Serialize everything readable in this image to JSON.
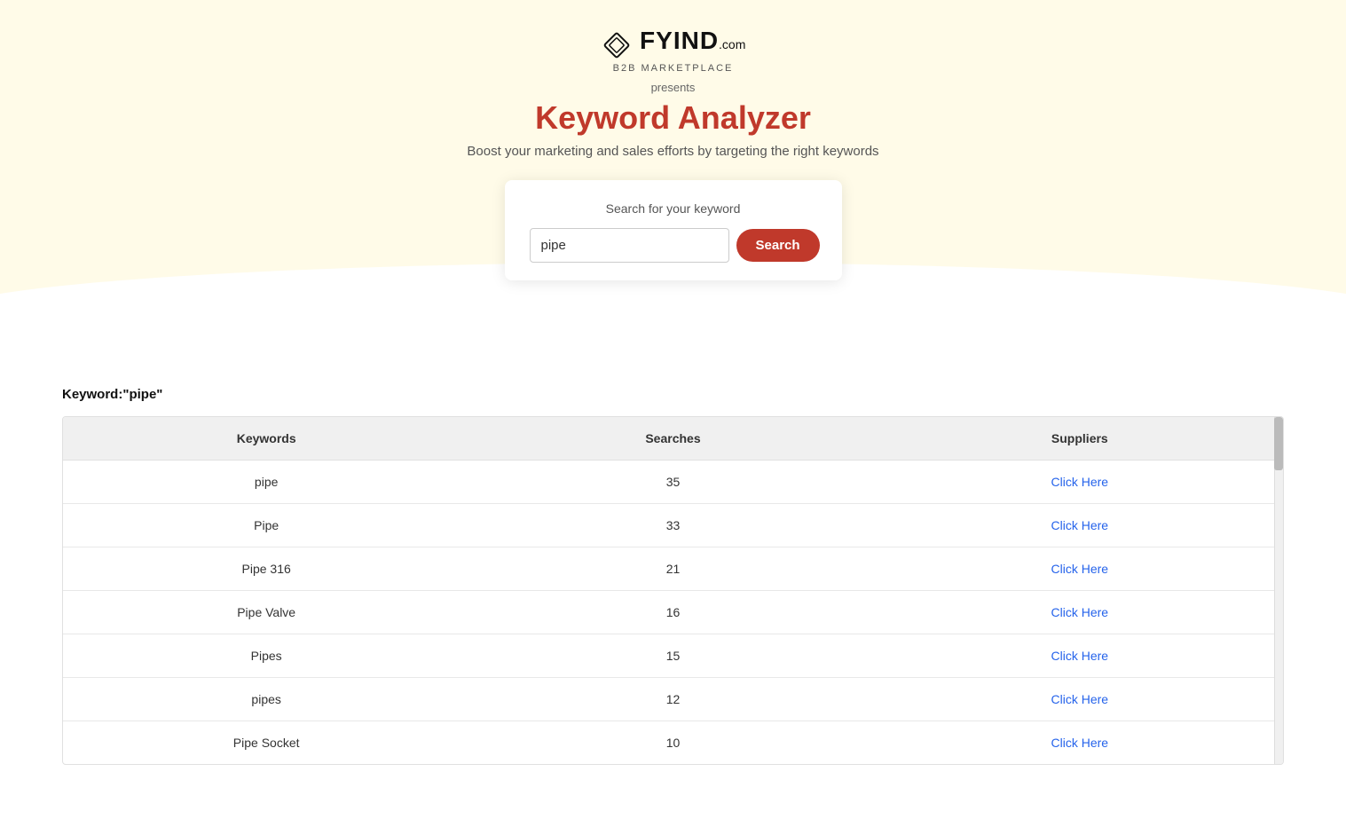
{
  "header": {
    "logo_text": "FYIND",
    "logo_com": ".com",
    "logo_tagline": "B2B marketplace",
    "presents": "presents",
    "title": "Keyword Analyzer",
    "subtitle": "Boost your marketing and sales efforts by targeting the right keywords"
  },
  "search": {
    "card_label": "Search for your keyword",
    "input_value": "pipe",
    "input_placeholder": "Enter keyword",
    "button_label": "Search"
  },
  "results": {
    "keyword_label": "Keyword:\"pipe\"",
    "columns": [
      "Keywords",
      "Searches",
      "Suppliers"
    ],
    "rows": [
      {
        "keyword": "pipe",
        "searches": "35",
        "link_text": "Click Here",
        "link_href": "#"
      },
      {
        "keyword": "Pipe",
        "searches": "33",
        "link_text": "Click Here",
        "link_href": "#"
      },
      {
        "keyword": "Pipe 316",
        "searches": "21",
        "link_text": "Click Here",
        "link_href": "#"
      },
      {
        "keyword": "Pipe Valve",
        "searches": "16",
        "link_text": "Click Here",
        "link_href": "#"
      },
      {
        "keyword": "Pipes",
        "searches": "15",
        "link_text": "Click Here",
        "link_href": "#"
      },
      {
        "keyword": "pipes",
        "searches": "12",
        "link_text": "Click Here",
        "link_href": "#"
      },
      {
        "keyword": "Pipe Socket",
        "searches": "10",
        "link_text": "Click Here",
        "link_href": "#"
      }
    ]
  },
  "colors": {
    "accent": "#c0392b",
    "link": "#2563eb",
    "header_bg": "#fffbe8"
  }
}
